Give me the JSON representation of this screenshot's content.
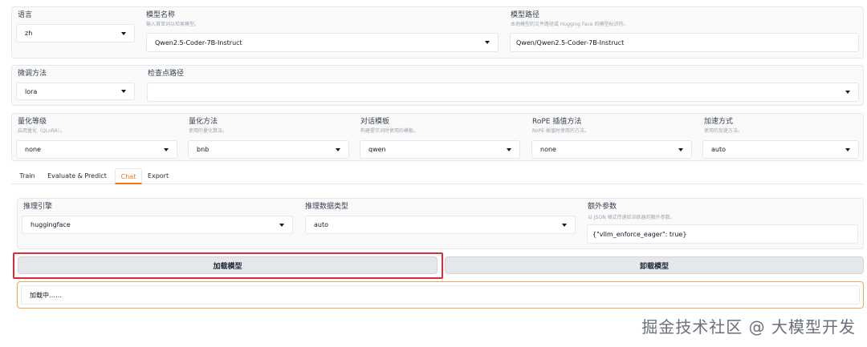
{
  "row1": {
    "language": {
      "label": "语言",
      "value": "zh"
    },
    "model_name": {
      "label": "模型名称",
      "hint": "输入首单词以检索模型。",
      "value": "Qwen2.5-Coder-7B-Instruct"
    },
    "model_path": {
      "label": "模型路径",
      "hint": "本地模型的文件路径或 Hugging Face 的模型标识符。",
      "value": "Qwen/Qwen2.5-Coder-7B-Instruct"
    }
  },
  "row2": {
    "finetune": {
      "label": "微调方法",
      "value": "lora"
    },
    "checkpoint": {
      "label": "检查点路径",
      "value": ""
    }
  },
  "row3": {
    "quant_bit": {
      "label": "量化等级",
      "hint": "启用量化（QLoRA）。",
      "value": "none"
    },
    "quant_method": {
      "label": "量化方法",
      "hint": "使用的量化算法。",
      "value": "bnb"
    },
    "template": {
      "label": "对话模板",
      "hint": "构建提示词时使用的模板。",
      "value": "qwen"
    },
    "rope": {
      "label": "RoPE 插值方法",
      "hint": "RoPE 插值时使用的方法。",
      "value": "none"
    },
    "booster": {
      "label": "加速方式",
      "hint": "使用的加速方法。",
      "value": "auto"
    }
  },
  "tabs": [
    "Train",
    "Evaluate & Predict",
    "Chat",
    "Export"
  ],
  "chat": {
    "infer_backend": {
      "label": "推理引擎",
      "value": "huggingface"
    },
    "infer_dtype": {
      "label": "推理数据类型",
      "value": "auto"
    },
    "extra_args": {
      "label": "额外参数",
      "hint": "以 JSON 格式传递给训练器的额外参数。",
      "value": "{\"vllm_enforce_eager\": true}"
    },
    "load_btn": "加载模型",
    "unload_btn": "卸载模型",
    "status": "加载中……"
  },
  "watermark": "掘金技术社区 @ 大模型开发",
  "colors": {
    "accent": "#f97316",
    "highlight": "#d92d3a"
  }
}
